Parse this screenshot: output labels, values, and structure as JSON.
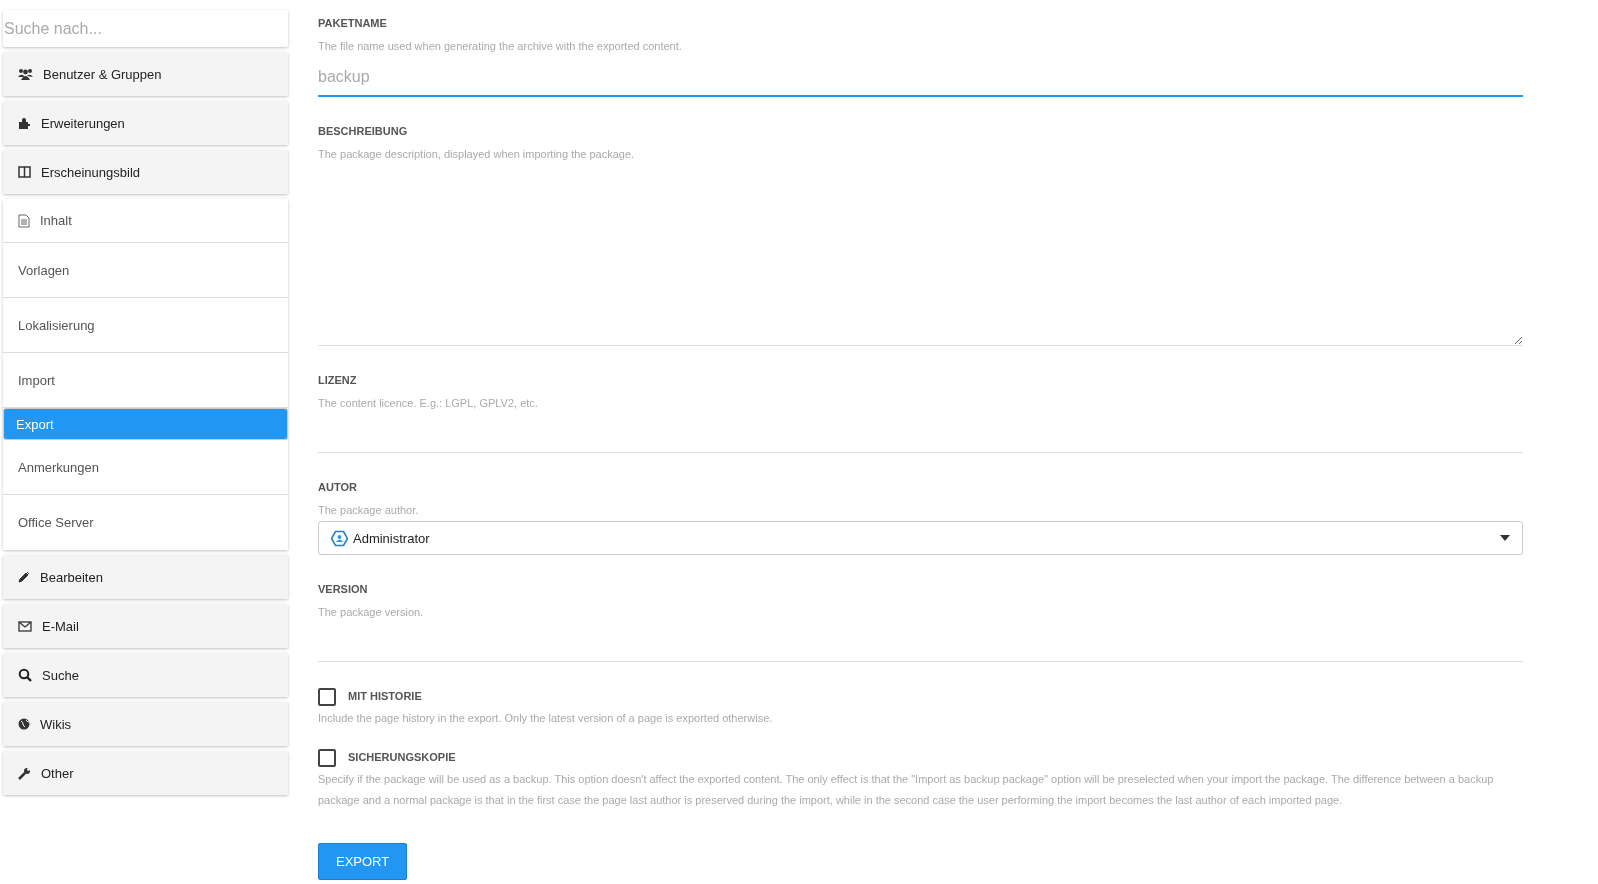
{
  "sidebar": {
    "search": {
      "placeholder": "Suche nach..."
    },
    "groups": [
      {
        "label": "Benutzer & Gruppen",
        "expanded": false
      },
      {
        "label": "Erweiterungen",
        "expanded": false
      },
      {
        "label": "Erscheinungsbild",
        "expanded": false
      },
      {
        "label": "Inhalt",
        "expanded": true,
        "children": [
          {
            "label": "Vorlagen",
            "selected": false
          },
          {
            "label": "Lokalisierung",
            "selected": false
          },
          {
            "label": "Import",
            "selected": false
          },
          {
            "label": "Export",
            "selected": true
          },
          {
            "label": "Anmerkungen",
            "selected": false
          },
          {
            "label": "Office Server",
            "selected": false
          }
        ]
      },
      {
        "label": "Bearbeiten",
        "expanded": false
      },
      {
        "label": "E-Mail",
        "expanded": false
      },
      {
        "label": "Suche",
        "expanded": false
      },
      {
        "label": "Wikis",
        "expanded": false
      },
      {
        "label": "Other",
        "expanded": false
      }
    ]
  },
  "form": {
    "fields": [
      {
        "kind": "text",
        "label": "PAKETNAME",
        "hint": "The file name used when generating the archive with the exported content.",
        "placeholder": "backup",
        "focused": true
      },
      {
        "kind": "textarea",
        "label": "BESCHREIBUNG",
        "hint": "The package description, displayed when importing the package."
      },
      {
        "kind": "text",
        "label": "LIZENZ",
        "hint": "The content licence. E.g.: LGPL, GPLV2, etc.",
        "focused": false
      },
      {
        "kind": "select",
        "label": "AUTOR",
        "hint": "The package author.",
        "value": "Administrator"
      },
      {
        "kind": "text",
        "label": "VERSION",
        "hint": "The package version.",
        "focused": false
      },
      {
        "kind": "checkbox",
        "label": "MIT HISTORIE",
        "hint": "Include the page history in the export. Only the latest version of a page is exported otherwise.",
        "checked": false
      },
      {
        "kind": "checkbox",
        "label": "SICHERUNGSKOPIE",
        "hint": "Specify if the package will be used as a backup. This option doesn't affect the exported content. The only effect is that the \"Import as backup package\" option will be preselected when your import the package. The difference between a backup package and a normal package is that in the first case the page last author is preserved during the import, while in the second case the user performing the import becomes the last author of each imported page.",
        "checked": false
      }
    ],
    "submit": "EXPORT"
  }
}
